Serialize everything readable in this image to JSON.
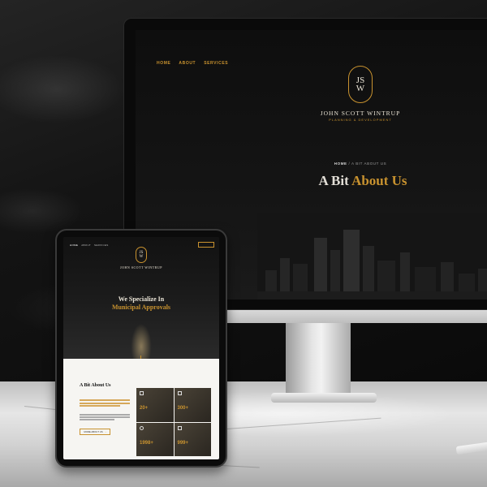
{
  "monitor": {
    "nav": [
      "HOME",
      "ABOUT",
      "SERVICES"
    ],
    "logo_letters_top": "JS",
    "logo_letters_bottom": "W",
    "brand": "JOHN SCOTT WINTRUP",
    "brand_sub": "PLANNING & DEVELOPMENT",
    "breadcrumb_home": "HOME",
    "breadcrumb_sep": "/",
    "breadcrumb_current": "A BIT ABOUT US",
    "title_plain": "A Bit",
    "title_gold": "About Us"
  },
  "tablet": {
    "nav": [
      "HOME",
      "ABOUT",
      "SERVICES"
    ],
    "phone": "",
    "contact_button": "",
    "logo_letters_top": "JS",
    "logo_letters_bottom": "W",
    "brand": "JOHN SCOTT WINTRUP",
    "kicker": "",
    "headline_white": "We Specialize In",
    "headline_gold": "Municipal Approvals",
    "about_heading": "A Bit About Us",
    "more_button": "MORE ABOUT US",
    "more_arrow": "›",
    "stats": [
      {
        "value": "20+",
        "label": ""
      },
      {
        "value": "300+",
        "label": ""
      },
      {
        "value": "1998+",
        "label": ""
      },
      {
        "value": "999+",
        "label": ""
      }
    ]
  },
  "colors": {
    "accent_gold": "#c8922f",
    "dark_bg": "#0f0f0f",
    "light_panel": "#f6f5f2"
  }
}
